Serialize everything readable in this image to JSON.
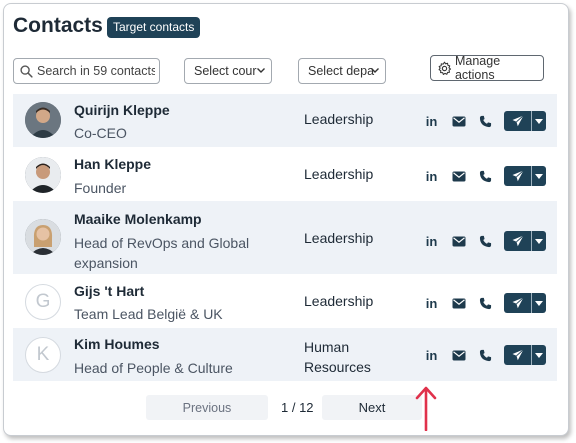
{
  "header": {
    "title": "Contacts",
    "badge": "Target contacts"
  },
  "filters": {
    "search_placeholder": "Search in 59 contacts",
    "country_select": "Select cour",
    "department_select": "Select depa",
    "manage_actions": "Manage actions"
  },
  "contacts": [
    {
      "name": "Quirijn Kleppe",
      "role": "Co-CEO",
      "department": "Leadership",
      "avatar": "photo"
    },
    {
      "name": "Han Kleppe",
      "role": "Founder",
      "department": "Leadership",
      "avatar": "photo"
    },
    {
      "name": "Maaike Molenkamp",
      "role": "Head of RevOps and Global expansion",
      "department": "Leadership",
      "avatar": "photo"
    },
    {
      "name": "Gijs 't Hart",
      "role": "Team Lead België & UK",
      "department": "Leadership",
      "avatar": "G"
    },
    {
      "name": "Kim Houmes",
      "role": "Head of People & Culture",
      "department": "Human Resources",
      "avatar": "K"
    }
  ],
  "icons": {
    "linkedin": "in",
    "email": "email-icon",
    "phone": "phone-icon",
    "send": "send-icon",
    "dropdown": "caret-down-icon"
  },
  "pagination": {
    "previous": "Previous",
    "page": "1 / 12",
    "next": "Next"
  },
  "colors": {
    "accent": "#1f4257",
    "row_alt": "#eef2f7",
    "arrow": "#e0314b"
  }
}
